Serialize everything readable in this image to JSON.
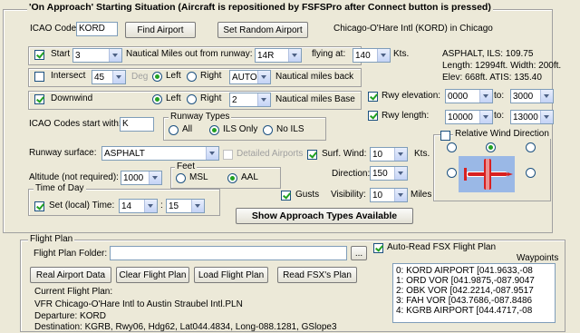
{
  "approach": {
    "title": "'On Approach' Starting Situation  (Aircraft is repositioned by FSFSPro after Connect button is pressed)",
    "icao_label": "ICAO Code:",
    "icao_value": "KORD",
    "find_airport": "Find Airport",
    "set_random": "Set Random Airport",
    "airport_name": "Chicago-O'Hare Intl (KORD) in Chicago",
    "start_label": "Start",
    "start_value": "3",
    "nm_runway_label": "Nautical Miles out from runway:",
    "runway_value": "14R",
    "flying_at_label": "flying at:",
    "speed_value": "140",
    "kts": "Kts.",
    "info_line1": "ASPHALT,  ILS: 109.75",
    "info_line2": "Length: 12994ft.  Width: 200ft.",
    "info_line3": "Elev: 668ft.  ATIS: 135.40",
    "intersect_label": "Intersect",
    "intersect_value": "45",
    "deg_label": "Deg",
    "left": "Left",
    "right": "Right",
    "auto_value": "AUTO",
    "nm_back_label": "Nautical miles back",
    "downwind_label": "Downwind",
    "downwind_value": "2",
    "nm_base_label": "Nautical miles Base",
    "rwy_elev_label": "Rwy elevation:",
    "rwy_elev_from": "0000",
    "rwy_elev_to": "3000",
    "to": "to:",
    "rwy_len_label": "Rwy length:",
    "rwy_len_from": "10000",
    "rwy_len_to": "13000",
    "icao_start_label": "ICAO Codes start with:",
    "icao_start_value": "K",
    "runway_types_title": "Runway Types",
    "rt_all": "All",
    "rt_ils": "ILS Only",
    "rt_noils": "No ILS",
    "rel_wind_title": "Relative Wind Direction",
    "surface_label": "Runway surface:",
    "surface_value": "ASPHALT",
    "detailed_airports": "Detailed Airports",
    "surf_wind_label": "Surf. Wind:",
    "surf_wind_value": "10",
    "direction_label": "Direction:",
    "direction_value": "150",
    "altitude_label": "Altitude (not required):",
    "altitude_value": "1000",
    "feet_title": "Feet",
    "msl": "MSL",
    "aal": "AAL",
    "time_title": "Time of Day",
    "set_time_label": "Set (local) Time:",
    "hour_value": "14",
    "colon": ":",
    "minute_value": "15",
    "gusts_label": "Gusts",
    "visibility_label": "Visibility:",
    "visibility_value": "10",
    "miles": "Miles",
    "show_types": "Show Approach Types Available"
  },
  "flightplan": {
    "title": "Flight Plan",
    "folder_label": "Flight Plan Folder:",
    "folder_value": "",
    "browse": "...",
    "autoread_label": "Auto-Read FSX Flight Plan",
    "waypoints_label": "Waypoints",
    "real_airport": "Real Airport Data",
    "clear_fp": "Clear Flight Plan",
    "load_fp": "Load Flight Plan",
    "read_fsx": "Read FSX's Plan",
    "current_label": "Current Flight Plan:",
    "current_value": "VFR Chicago-O'Hare Intl to Austin Straubel Intl.PLN",
    "departure": "Departure: KORD",
    "destination": "Destination: KGRB, Rwy06, Hdg62, Lat044.4834, Long-088.1281, GSlope3",
    "waypoints": [
      "0: KORD AIRPORT [041.9633,-08",
      "1: ORD VOR [041.9875,-087.9047",
      "2: OBK VOR [042.2214,-087.9517",
      "3: FAH VOR [043.7686,-087.8486",
      "4: KGRB AIRPORT [044.4717,-08"
    ]
  }
}
